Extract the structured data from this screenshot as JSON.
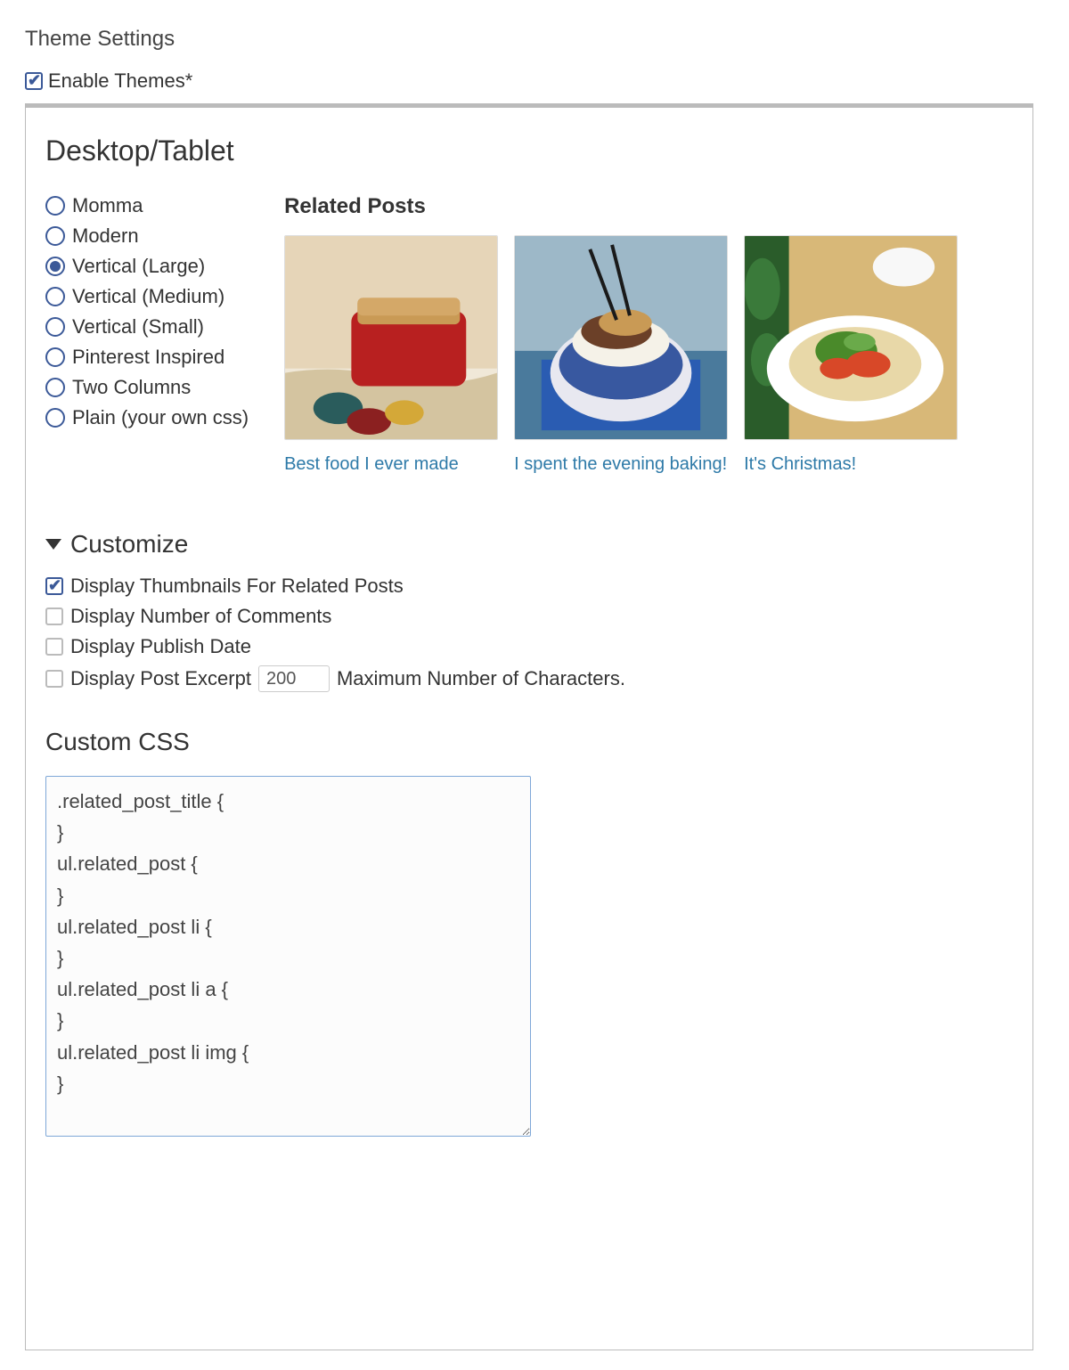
{
  "page_title": "Theme Settings",
  "enable_label": "Enable Themes*",
  "enable_checked": true,
  "section_heading": "Desktop/Tablet",
  "themes": [
    {
      "label": "Momma",
      "selected": false
    },
    {
      "label": "Modern",
      "selected": false
    },
    {
      "label": "Vertical (Large)",
      "selected": true
    },
    {
      "label": "Vertical (Medium)",
      "selected": false
    },
    {
      "label": "Vertical (Small)",
      "selected": false
    },
    {
      "label": "Pinterest Inspired",
      "selected": false
    },
    {
      "label": "Two Columns",
      "selected": false
    },
    {
      "label": "Plain (your own css)",
      "selected": false
    }
  ],
  "preview": {
    "title": "Related Posts",
    "posts": [
      {
        "caption": "Best food I ever made"
      },
      {
        "caption": "I spent the evening baking!"
      },
      {
        "caption": "It's Christmas!"
      }
    ]
  },
  "customize": {
    "heading": "Customize",
    "options": [
      {
        "label": "Display Thumbnails For Related Posts",
        "checked": true
      },
      {
        "label": "Display Number of Comments",
        "checked": false
      },
      {
        "label": "Display Publish Date",
        "checked": false
      }
    ],
    "excerpt": {
      "label": "Display Post Excerpt",
      "checked": false,
      "value": "200",
      "suffix": "Maximum Number of Characters."
    }
  },
  "custom_css": {
    "heading": "Custom CSS",
    "value": ".related_post_title {\n}\nul.related_post {\n}\nul.related_post li {\n}\nul.related_post li a {\n}\nul.related_post li img {\n}"
  }
}
